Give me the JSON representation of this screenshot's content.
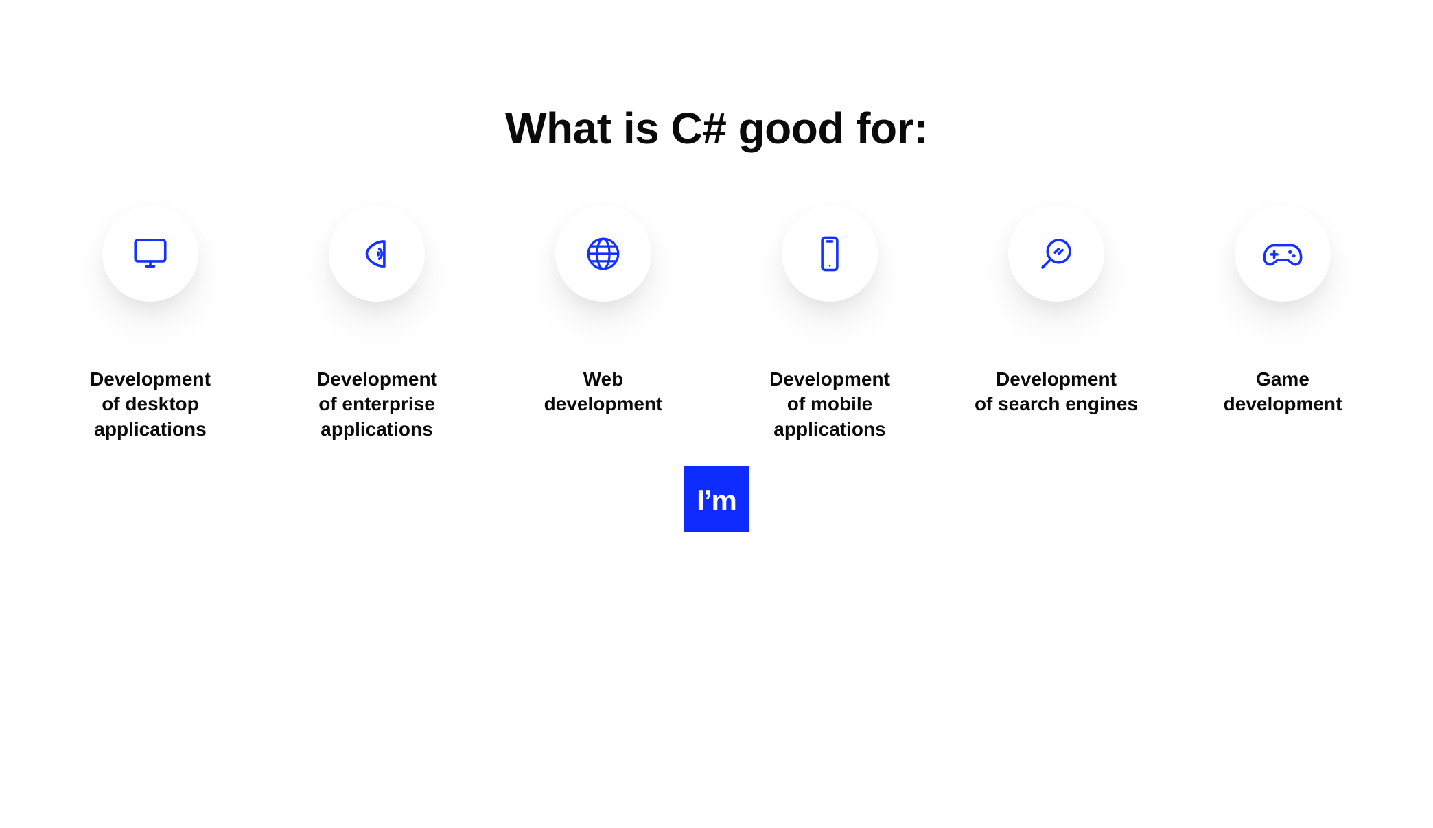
{
  "colors": {
    "accent": "#1431ff",
    "logo_bg": "#0f2cff",
    "text": "#0a0a0a",
    "bg": "#ffffff"
  },
  "title": "What is C# good for:",
  "items": [
    {
      "icon": "monitor-icon",
      "label": "Development\nof desktop\napplications"
    },
    {
      "icon": "speaker-icon",
      "label": "Development\nof enterprise\napplications"
    },
    {
      "icon": "globe-icon",
      "label": "Web\ndevelopment"
    },
    {
      "icon": "phone-icon",
      "label": "Development\nof mobile\napplications"
    },
    {
      "icon": "magnifier-icon",
      "label": "Development\nof search engines"
    },
    {
      "icon": "gamepad-icon",
      "label": "Game\ndevelopment"
    }
  ],
  "logo_text": "I’m"
}
